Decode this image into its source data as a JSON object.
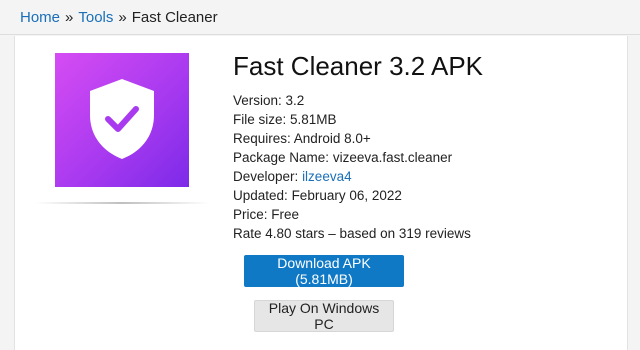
{
  "breadcrumb": {
    "home": "Home",
    "tools": "Tools",
    "current": "Fast Cleaner",
    "separator": "»"
  },
  "app": {
    "title": "Fast Cleaner 3.2 APK",
    "icon_name": "shield-check-icon",
    "icon_gradient": [
      "#d64cf3",
      "#7c2ae8"
    ],
    "version_label": "Version:",
    "version": "3.2",
    "filesize_label": "File size:",
    "filesize": "5.81MB",
    "requires_label": "Requires:",
    "requires": "Android 8.0+",
    "package_label": "Package Name:",
    "package": "vizeeva.fast.cleaner",
    "developer_label": "Developer:",
    "developer": "ilzeeva4",
    "updated_label": "Updated:",
    "updated": "February 06, 2022",
    "price_label": "Price:",
    "price": "Free",
    "rating_text": "Rate 4.80 stars – based on 319 reviews"
  },
  "buttons": {
    "download": "Download APK (5.81MB)",
    "play_pc": "Play On Windows PC"
  },
  "colors": {
    "link": "#1a6fb8",
    "primary_button": "#0f79c6",
    "secondary_button": "#e6e6e6"
  }
}
